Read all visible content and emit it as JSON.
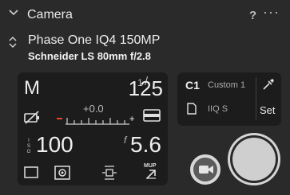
{
  "header": {
    "title": "Camera",
    "help": "?",
    "more": "···"
  },
  "camera": {
    "model": "Phase One IQ4 150MP",
    "lens": "Schneider LS 80mm f/2.8"
  },
  "exposure": {
    "mode": "M",
    "shutter_numerator": "1",
    "shutter_slash": "/",
    "shutter_denominator": "125",
    "ev": "+0.0",
    "iso_value": "100",
    "f_label": "f",
    "aperture": "5.6",
    "mup_label": "MUP"
  },
  "capture_settings": {
    "set_name": "C1",
    "set_label": "Custom 1",
    "format": "IIQ S",
    "set_button": "Set"
  },
  "colors": {
    "panel": "#1c1c1c",
    "background": "#2a2a2a",
    "accent_red": "#e8472f"
  },
  "icons": [
    "chevron-down-icon",
    "help-icon",
    "more-icon",
    "up-down-icon",
    "battery-off-icon",
    "card-icon",
    "iso-icon",
    "drive-single-icon",
    "metering-icon",
    "af-icon",
    "mirror-up-icon",
    "eyedropper-icon",
    "document-icon",
    "video-camera-icon",
    "shutter-button"
  ]
}
